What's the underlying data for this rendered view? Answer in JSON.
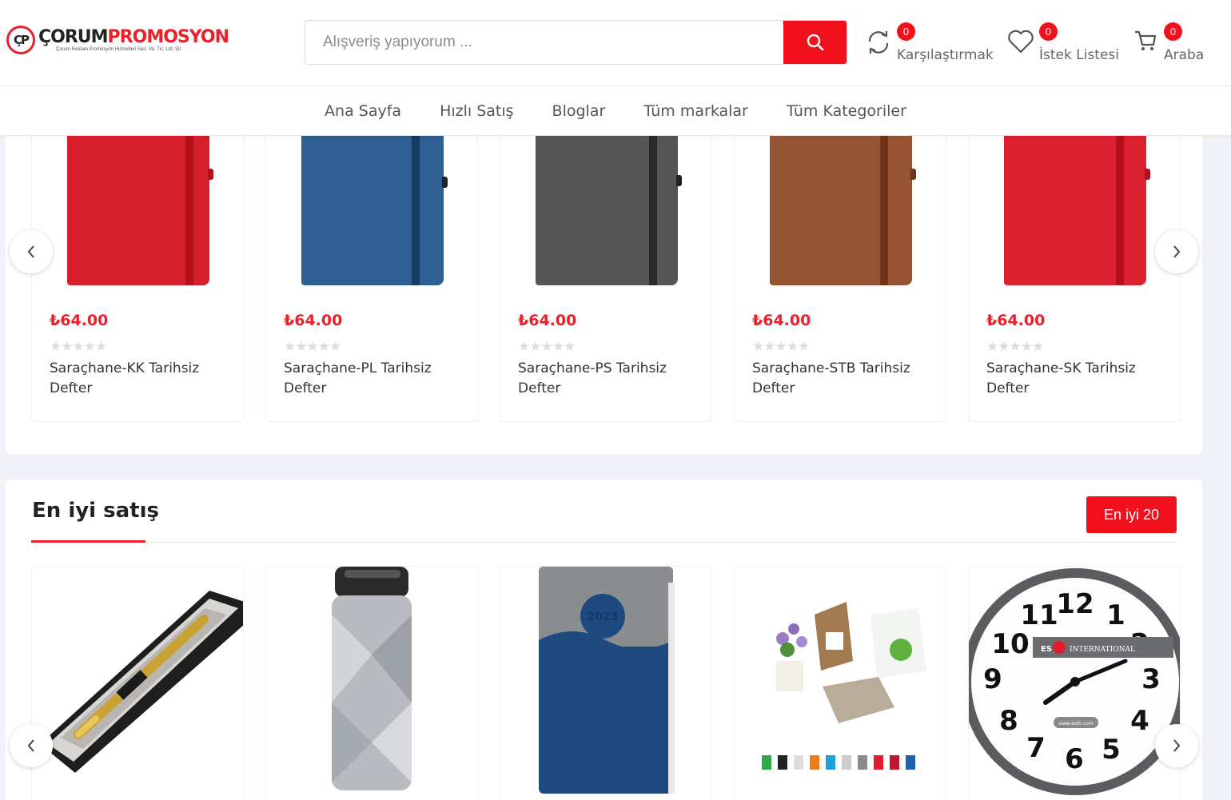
{
  "header": {
    "logo": {
      "badge": "ÇP",
      "main_a": "ÇORUM",
      "main_b": "PROMOSYON",
      "sub": "Çorum Reklam Promosyon Hizmetleri San. Ve. Tic. Ltd. Şti."
    },
    "search": {
      "placeholder": "Alışveriş yapıyorum ..."
    },
    "compare": {
      "label": "Karşılaştırmak",
      "count": "0"
    },
    "wishlist": {
      "label": "İstek Listesi",
      "count": "0"
    },
    "cart": {
      "label": "Araba",
      "count": "0"
    }
  },
  "nav": {
    "items": [
      "Ana Sayfa",
      "Hızlı Satış",
      "Bloglar",
      "Tüm markalar",
      "Tüm Kategoriler"
    ]
  },
  "products": [
    {
      "price": "₺64.00",
      "name": "Saraçhane-KK Tarihsiz Defter",
      "rating": 0,
      "color": "#d61f2c",
      "band": "#b3101b"
    },
    {
      "price": "₺64.00",
      "name": "Saraçhane-PL Tarihsiz Defter",
      "rating": 0,
      "color": "#2f5e91",
      "band": "#163a62"
    },
    {
      "price": "₺64.00",
      "name": "Saraçhane-PS Tarihsiz Defter",
      "rating": 0,
      "color": "#555555",
      "band": "#2a2a2a"
    },
    {
      "price": "₺64.00",
      "name": "Saraçhane-STB Tarihsiz Defter",
      "rating": 0,
      "color": "#955534",
      "band": "#6e3417"
    },
    {
      "price": "₺64.00",
      "name": "Saraçhane-SK Tarihsiz Defter",
      "rating": 0,
      "color": "#db2030",
      "band": "#b3101b"
    }
  ],
  "stars": "★★★★★",
  "bestsellers": {
    "title": "En iyi satış",
    "button": "En iyi 20",
    "clock": {
      "n12": "12",
      "n11": "11",
      "n10": "10",
      "n9": "9",
      "n8": "8",
      "n7": "7",
      "n6": "6",
      "n5": "5",
      "n4": "4",
      "n3": "3",
      "n2": "2",
      "n1": "1",
      "brand_a": "ES",
      "brand_b": "INTERNATIONAL",
      "site": "www.esitr.com"
    },
    "diary_year": "2023"
  },
  "colors": {
    "accent": "#f0111d",
    "price": "#e8212b"
  }
}
